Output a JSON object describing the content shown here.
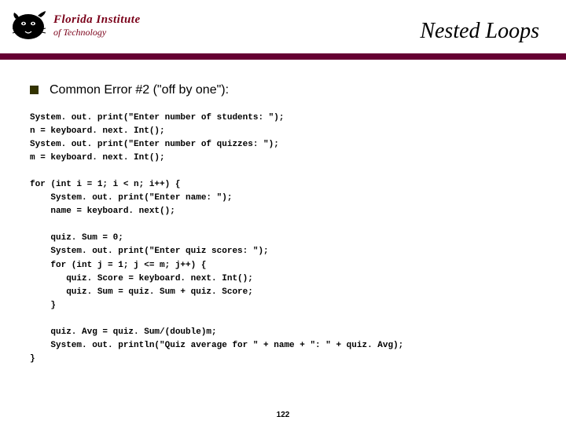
{
  "logo": {
    "line1": "Florida Institute",
    "line2": "of Technology"
  },
  "title": "Nested Loops",
  "bullet": "Common Error #2 (\"off by one\"):",
  "code": "System. out. print(\"Enter number of students: \");\nn = keyboard. next. Int();\nSystem. out. print(\"Enter number of quizzes: \");\nm = keyboard. next. Int();\n\nfor (int i = 1; i < n; i++) {\n    System. out. print(\"Enter name: \");\n    name = keyboard. next();\n\n    quiz. Sum = 0;\n    System. out. print(\"Enter quiz scores: \");\n    for (int j = 1; j <= m; j++) {\n       quiz. Score = keyboard. next. Int();\n       quiz. Sum = quiz. Sum + quiz. Score;\n    }\n\n    quiz. Avg = quiz. Sum/(double)m;\n    System. out. println(\"Quiz average for \" + name + \": \" + quiz. Avg);\n}",
  "page": "122"
}
